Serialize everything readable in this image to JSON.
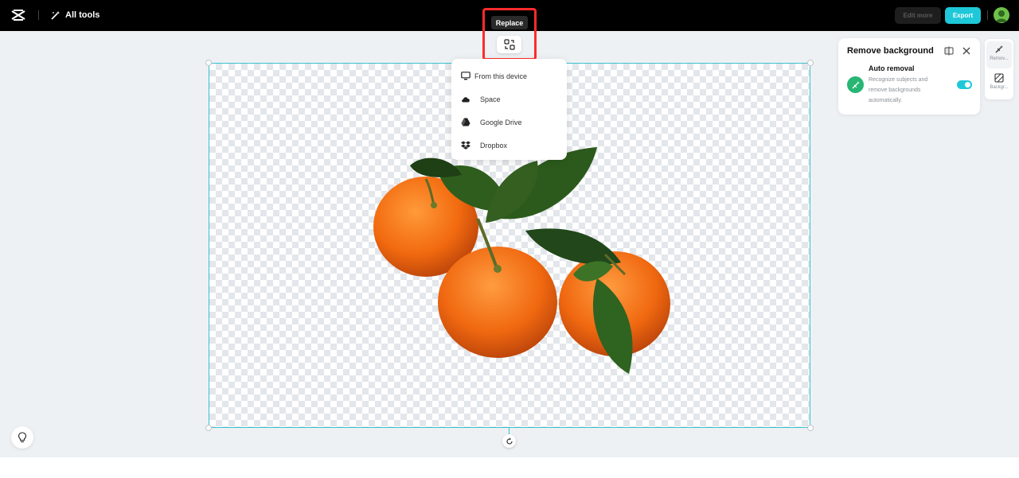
{
  "topbar": {
    "all_tools_label": "All tools",
    "edit_more_label": "Edit more",
    "export_label": "Export",
    "accent_color": "#1ec8d8"
  },
  "replace": {
    "tooltip": "Replace",
    "icon": "replace-icon"
  },
  "dropdown": {
    "items": [
      {
        "label": "From this device",
        "icon": "monitor-icon"
      },
      {
        "label": "Space",
        "icon": "cloud-icon"
      },
      {
        "label": "Google Drive",
        "icon": "google-drive-icon"
      },
      {
        "label": "Dropbox",
        "icon": "dropbox-icon"
      }
    ]
  },
  "panel": {
    "title": "Remove background",
    "auto_removal": {
      "title": "Auto removal",
      "description": "Recognize subjects and remove backgrounds automatically.",
      "enabled": true
    }
  },
  "side_toolbar": {
    "items": [
      {
        "label": "Remov...",
        "icon": "remove-bg-icon",
        "active": true
      },
      {
        "label": "Backgr...",
        "icon": "background-icon",
        "active": false
      }
    ]
  },
  "canvas": {
    "border_color": "#39c1cf"
  }
}
